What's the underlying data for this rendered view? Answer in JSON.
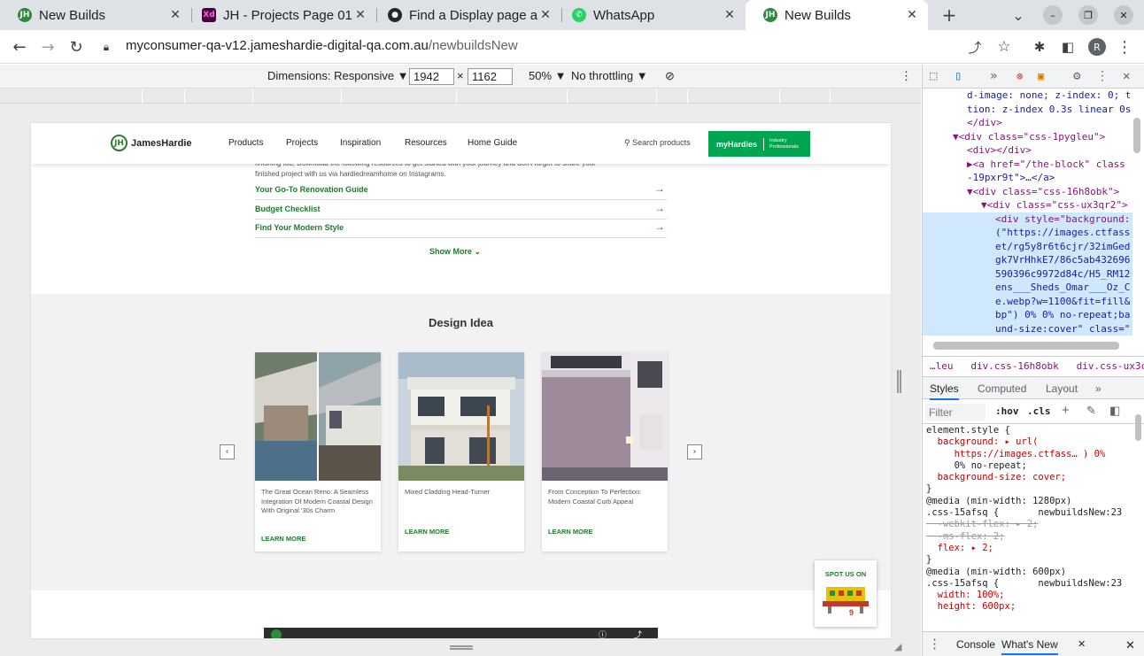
{
  "browser": {
    "tabs": [
      {
        "title": "New Builds",
        "icon": "jameshardie-favicon",
        "active": false
      },
      {
        "title": "JH - Projects Page 01",
        "icon": "adobe-xd-favicon",
        "active": false
      },
      {
        "title": "Find a Display page a",
        "icon": "github-favicon",
        "active": false
      },
      {
        "title": "WhatsApp",
        "icon": "whatsapp-favicon",
        "active": false
      },
      {
        "title": "New Builds",
        "icon": "jameshardie-favicon",
        "active": true
      }
    ],
    "url_host": "myconsumer-qa-v12.jameshardie-digital-qa.com.au",
    "url_path": "/newbuildsNew",
    "profile_initial": "R"
  },
  "device_toolbar": {
    "dimensions_label": "Dimensions: Responsive ▼",
    "width": "1942",
    "times": "×",
    "height": "1162",
    "zoom": "50% ▼",
    "throttling": "No throttling ▼"
  },
  "site": {
    "logo_text": "JamesHardie",
    "logo_mark": "JH",
    "nav": [
      "Products",
      "Projects",
      "Inspiration",
      "Resources",
      "Home Guide"
    ],
    "search_label": "Search products",
    "myhardies_label": "myHardies",
    "industry_line1": "Industry",
    "industry_line2": "Professionals",
    "cut_text_line1": "finishing tou, Download the following resources to get started with your journey and don't forget to share your",
    "cut_text_line2": "finished project with us via hardiedreamhome on Instagrams.",
    "resource_links": [
      "Your Go-To Renovation Guide",
      "Budget Checklist",
      "Find Your Modern Style"
    ],
    "show_more": "Show More",
    "design_title": "Design Idea",
    "cards": [
      {
        "title": "The Great Ocean Reno: A Seamless Integration Of Modern Coastal Design With Original '30s Charm",
        "cta": "LEARN MORE"
      },
      {
        "title": "Mixed Cladding Head-Turner",
        "cta": "LEARN MORE"
      },
      {
        "title": "From Conception To Perfection: Modern Coastal Curb Appeal",
        "cta": "LEARN MORE"
      }
    ],
    "spot_label": "SPOT US ON",
    "spot_logo_text": "9"
  },
  "devtools": {
    "elements_code": [
      {
        "indent": 6,
        "html": "d-image: none; z-index: 0; t"
      },
      {
        "indent": 6,
        "html": "tion: z-index 0.3s linear 0s"
      },
      {
        "indent": 6,
        "html": "</div>"
      },
      {
        "indent": 4,
        "html": "▼<div class=\"css-1pygleu\">"
      },
      {
        "indent": 6,
        "html": "<div></div>"
      },
      {
        "indent": 6,
        "html": "▶<a href=\"/the-block\" class"
      },
      {
        "indent": 6,
        "html": "-19pxr9t\">…</a>"
      },
      {
        "indent": 6,
        "html": "▼<div class=\"css-16h8obk\">"
      },
      {
        "indent": 8,
        "html": "▼<div class=\"css-ux3qr2\">"
      },
      {
        "indent": 10,
        "html": "<div style=\"background:"
      },
      {
        "indent": 10,
        "html": "(\"https://images.ctfass"
      },
      {
        "indent": 10,
        "html": "et/rg5y8r6t6cjr/32imGed"
      },
      {
        "indent": 10,
        "html": "gk7VrHhkE7/86c5ab432696"
      },
      {
        "indent": 10,
        "html": "590396c9972d84c/H5_RM12"
      },
      {
        "indent": 10,
        "html": "ens___Sheds_Omar___Oz_C"
      },
      {
        "indent": 10,
        "html": "e.webp?w=1100&fit=fill&"
      },
      {
        "indent": 10,
        "html": "bp\") 0% 0% no-repeat;ba"
      },
      {
        "indent": 10,
        "html": "und-size:cover\" class=\""
      }
    ],
    "breadcrumbs": [
      "…leu",
      "div.css-16h8obk",
      "div.css-ux3c"
    ],
    "panel_tabs": [
      "Styles",
      "Computed",
      "Layout",
      "»"
    ],
    "filter_placeholder": "Filter",
    "hov": ":hov",
    "cls": ".cls",
    "styles_lines": [
      "element.style {",
      "  background: ▸ url(",
      "     https://images.ctfass… ) 0%",
      "     0% no-repeat;",
      "  background-size: cover;",
      "}",
      "@media (min-width: 1280px)",
      ".css-15afsq {       newbuildsNew:23",
      "  -webkit-flex: ▸ 2;",
      "  -ms-flex: 2;",
      "  flex: ▸ 2;",
      "}",
      "@media (min-width: 600px)",
      ".css-15afsq {       newbuildsNew:23",
      "  width: 100%;",
      "  height: 600px;"
    ],
    "drawer_tabs": [
      "Console",
      "What's New"
    ]
  }
}
